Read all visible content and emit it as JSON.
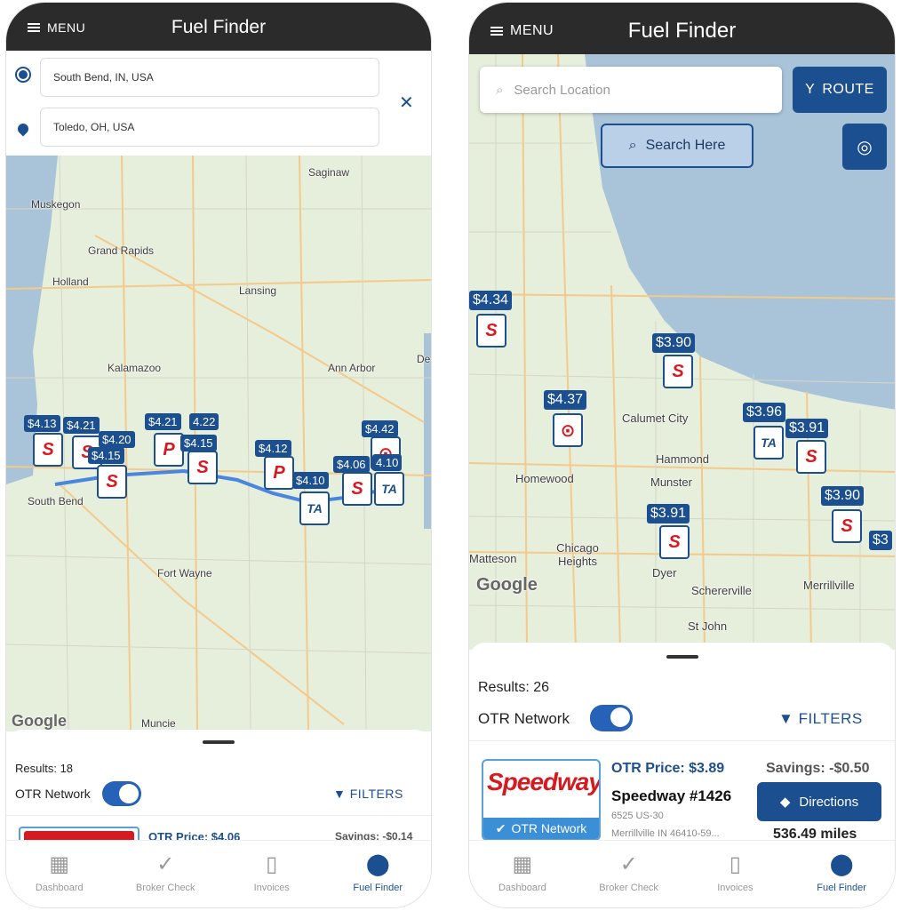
{
  "left": {
    "menu_label": "MENU",
    "title": "Fuel Finder",
    "origin": "South Bend, IN, USA",
    "destination": "Toledo, OH, USA",
    "map_labels": [
      "Saginaw",
      "Muskegon",
      "Grand Rapids",
      "Holland",
      "Lansing",
      "Kalamazoo",
      "Ann Arbor",
      "De",
      "South Bend",
      "Fort Wayne",
      "Muncie"
    ],
    "google": "Google",
    "prices": [
      "$4.13",
      "$4.21",
      "$4.20",
      "$4.15",
      "$4.21",
      "4.22",
      "$4.15",
      "$4.12",
      "$4.10",
      "$4.06",
      "$4.42",
      "4.10"
    ],
    "results": "Results: 18",
    "otr_network": "OTR Network",
    "filters": "FILTERS",
    "otr_price": "OTR Price: $4.06",
    "savings": "Savings: -$0.14",
    "nav": [
      "Dashboard",
      "Broker Check",
      "Invoices",
      "Fuel Finder"
    ]
  },
  "right": {
    "menu_label": "MENU",
    "title": "Fuel Finder",
    "search_placeholder": "Search Location",
    "route_label": "ROUTE",
    "search_here": "Search Here",
    "map_labels": [
      "Calumet City",
      "Hammond",
      "Homewood",
      "Munster",
      "Chicago Heights",
      "Matteson",
      "Dyer",
      "Schererville",
      "Merrillville",
      "St John"
    ],
    "google": "Google",
    "prices": [
      "$4.34",
      "$3.90",
      "$4.37",
      "$3.96",
      "$3.91",
      "$3.90",
      "$3.91",
      "$3"
    ],
    "results": "Results: 26",
    "otr_network": "OTR Network",
    "filters": "FILTERS",
    "card": {
      "brand": "Speedway",
      "badge": "OTR Network",
      "otr_price": "OTR Price: $3.89",
      "savings": "Savings: -$0.50",
      "name": "Speedway #1426",
      "address1": "6525 US-30",
      "address2": "Merrillville IN 46410-59...",
      "directions": "Directions",
      "distance": "536.49 miles"
    },
    "nav": [
      "Dashboard",
      "Broker Check",
      "Invoices",
      "Fuel Finder"
    ]
  },
  "colors": {
    "primary": "#1c4f8f",
    "toggle": "#2662b8",
    "speedway_red": "#d71920",
    "topbar": "#2b2b2b",
    "water": "#a9c3d8",
    "map_land": "#e6eedc"
  },
  "icons": {
    "menu": "hamburger-icon",
    "origin": "radio-dot-icon",
    "destination": "map-pin-icon",
    "clear": "close-icon",
    "search": "search-icon",
    "route": "route-fork-icon",
    "locate": "crosshair-icon",
    "filter": "funnel-icon",
    "dashboard": "grid-icon",
    "broker": "check-circle-icon",
    "invoices": "document-icon",
    "fuel": "map-pin-icon"
  }
}
